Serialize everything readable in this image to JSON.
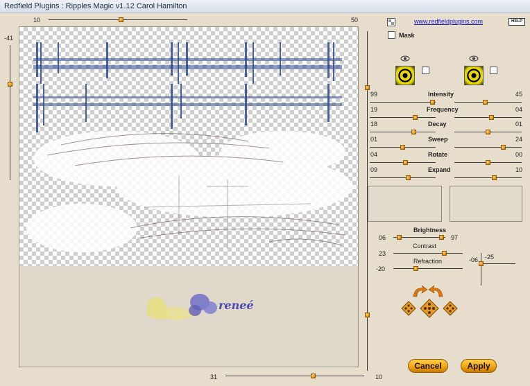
{
  "window": {
    "title": "Redfield Plugins : Ripples Magic v1.12   Carol Hamilton"
  },
  "preview": {
    "top_slider_value": "10",
    "top_slider_right_label": "50",
    "left_slider_value": "-41",
    "bottom_slider_value": "31",
    "right_slider_value": "10",
    "watermark_text": "reneé"
  },
  "header": {
    "link_text": "www.redfieldplugins.com",
    "help_label": "HELP",
    "mask_label": "Mask"
  },
  "ripple_params": [
    {
      "label": "Intensity",
      "left_value": "99",
      "right_value": "45",
      "left_pos": 0.99,
      "right_pos": 0.45
    },
    {
      "label": "Frequency",
      "left_value": "19",
      "right_value": "04",
      "left_pos": 0.7,
      "right_pos": 0.55
    },
    {
      "label": "Decay",
      "left_value": "18",
      "right_value": "01",
      "left_pos": 0.68,
      "right_pos": 0.5
    },
    {
      "label": "Sweep",
      "left_value": "01",
      "right_value": "24",
      "left_pos": 0.5,
      "right_pos": 0.74
    },
    {
      "label": "Rotate",
      "left_value": "04",
      "right_value": "00",
      "left_pos": 0.54,
      "right_pos": 0.5
    },
    {
      "label": "Expand",
      "left_value": "09",
      "right_value": "10",
      "left_pos": 0.59,
      "right_pos": 0.6
    }
  ],
  "lighting": {
    "brightness_label": "Brightness",
    "brightness_left": "06",
    "brightness_right": "97",
    "contrast_label": "Contrast",
    "contrast_value": "23",
    "refraction_label": "Refraction",
    "refraction_value": "-20",
    "xy_x": "-06",
    "xy_y": "-25"
  },
  "actions": {
    "cancel_label": "Cancel",
    "apply_label": "Apply"
  }
}
